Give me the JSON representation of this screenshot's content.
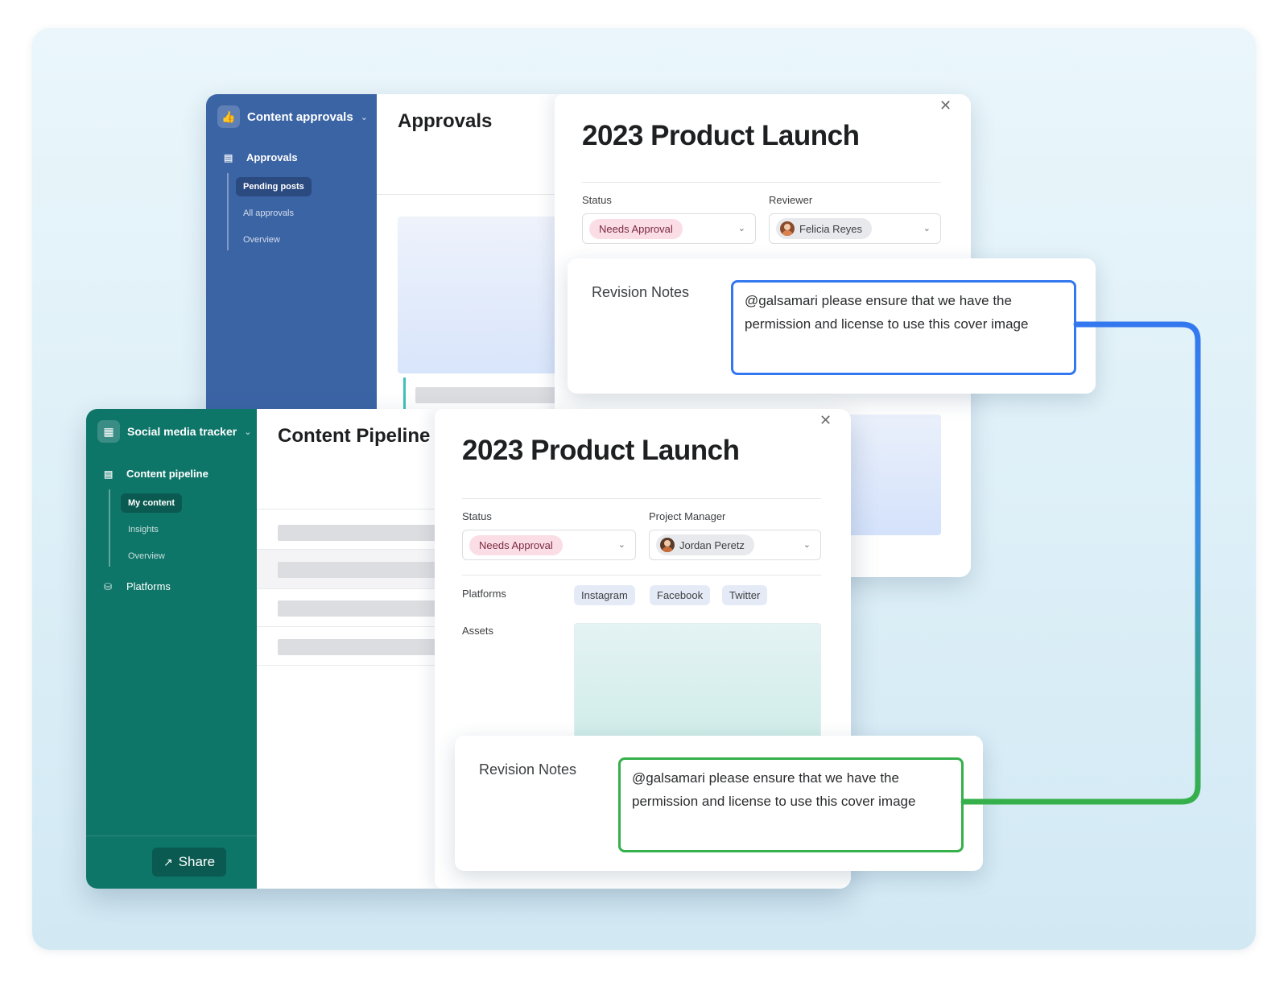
{
  "colors": {
    "approvals_sidebar": "#3b64a5",
    "tracker_sidebar": "#0e7569",
    "connector_blue": "#3478f0",
    "connector_green": "#35b04a",
    "status_chip": "#fbdde6"
  },
  "back_window": {
    "workspace": {
      "icon": "thumbs-up-icon",
      "title": "Content approvals"
    },
    "nav": {
      "section": "Approvals",
      "items": [
        "Pending posts",
        "All approvals",
        "Overview"
      ],
      "active_index": 0
    },
    "main_title": "Approvals",
    "detail": {
      "title": "2023 Product Launch",
      "status": {
        "label": "Status",
        "value": "Needs Approval"
      },
      "reviewer": {
        "label": "Reviewer",
        "value": "Felicia Reyes"
      }
    },
    "revision": {
      "label": "Revision Notes",
      "text": "@galsamari please ensure that we have the permission and license to use this cover image"
    }
  },
  "front_window": {
    "workspace": {
      "icon": "calendar-icon",
      "title": "Social media tracker"
    },
    "nav": {
      "section": "Content pipeline",
      "items": [
        "My content",
        "Insights",
        "Overview"
      ],
      "active_index": 0,
      "extra": "Platforms"
    },
    "share_label": "Share",
    "main_title": "Content Pipeline",
    "detail": {
      "title": "2023 Product Launch",
      "status": {
        "label": "Status",
        "value": "Needs Approval"
      },
      "manager": {
        "label": "Project Manager",
        "value": "Jordan Peretz"
      },
      "platforms": {
        "label": "Platforms",
        "values": [
          "Instagram",
          "Facebook",
          "Twitter"
        ]
      },
      "assets": {
        "label": "Assets"
      }
    },
    "revision": {
      "label": "Revision Notes",
      "text": "@galsamari please ensure that we have the permission and license to use this cover image"
    }
  }
}
